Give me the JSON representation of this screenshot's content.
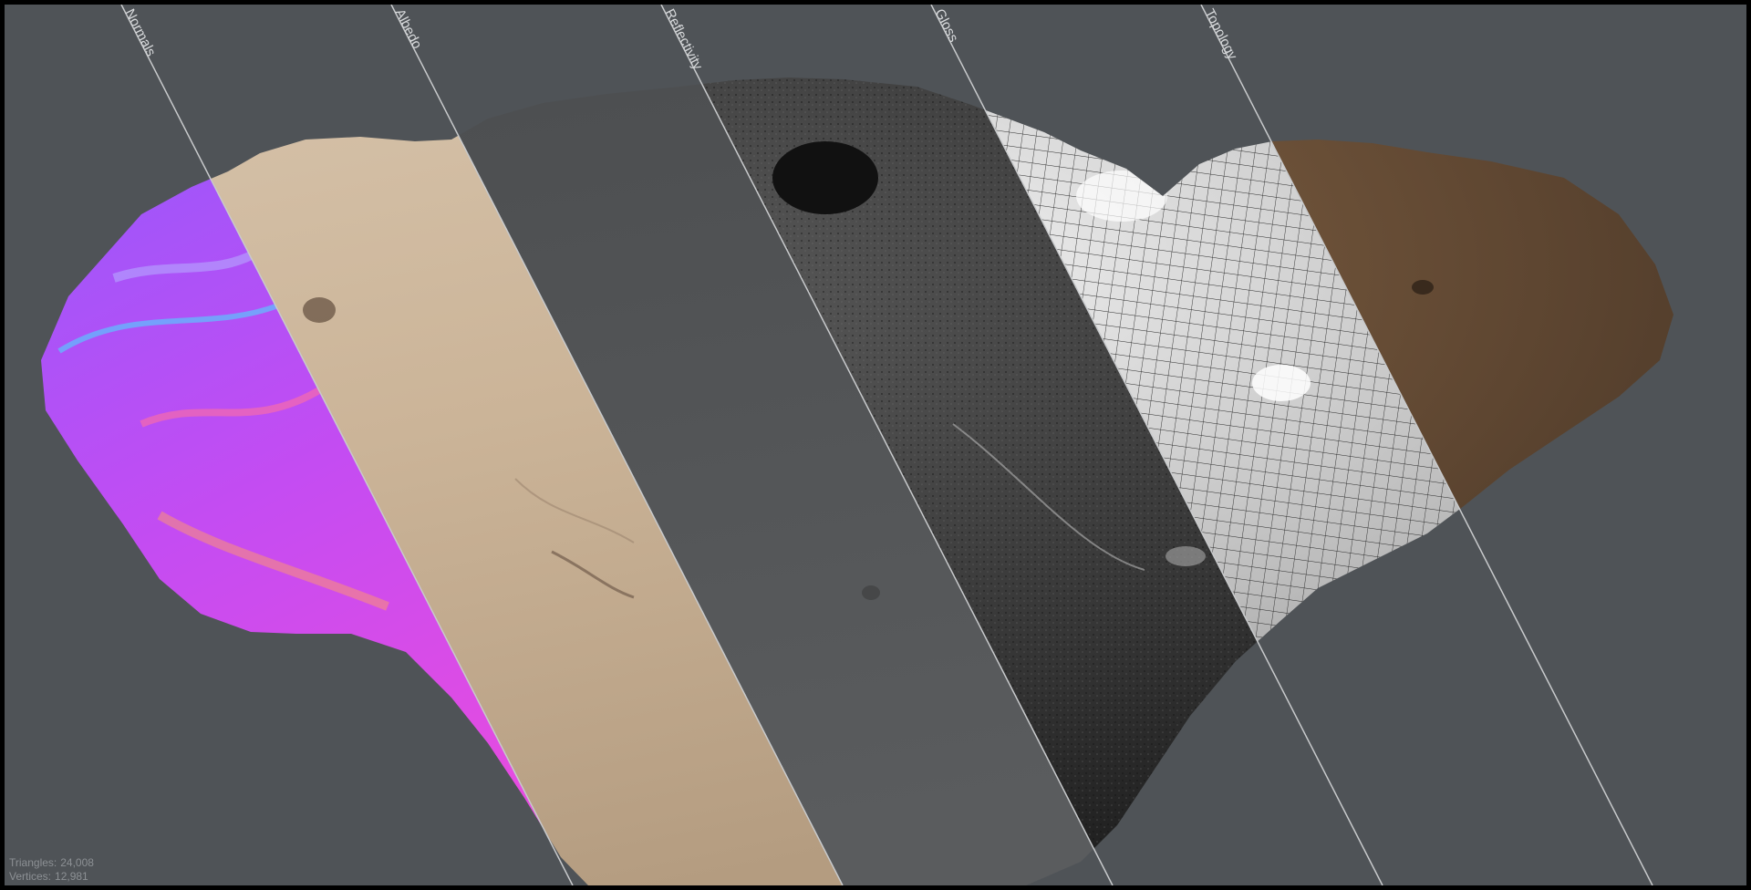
{
  "viewer": {
    "background_color": "#4f5357",
    "divider_color": "#c8cacc",
    "layers": [
      {
        "key": "normals",
        "label": "Normals"
      },
      {
        "key": "albedo",
        "label": "Albedo"
      },
      {
        "key": "reflectivity",
        "label": "Reflectivity"
      },
      {
        "key": "gloss",
        "label": "Gloss"
      },
      {
        "key": "topology",
        "label": "Topology"
      }
    ],
    "stats": {
      "triangles_label": "Triangles:",
      "triangles_value": "24,008",
      "vertices_label": "Vertices:",
      "vertices_value": "12,981"
    }
  }
}
